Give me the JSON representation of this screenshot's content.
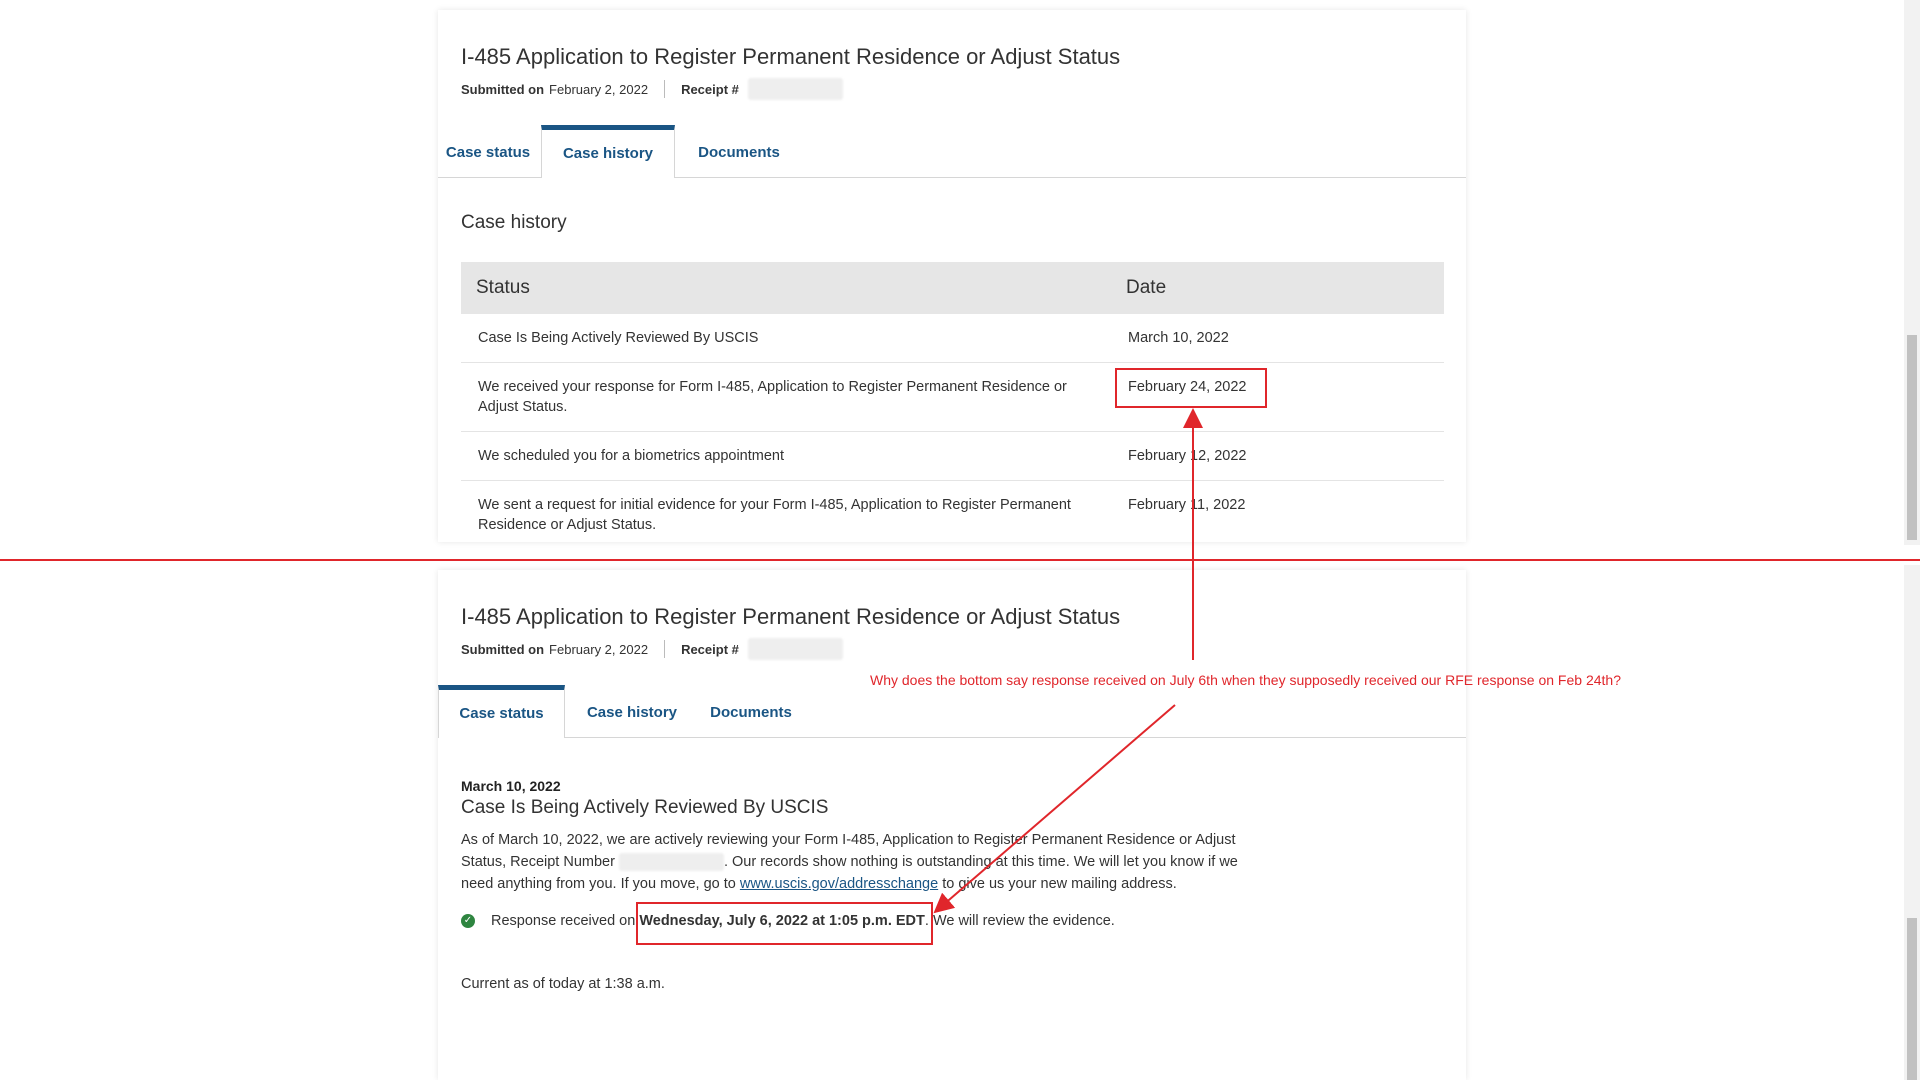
{
  "panel_top": {
    "form_title": "I-485 Application to Register Permanent Residence or Adjust Status",
    "submitted_label": "Submitted on",
    "submitted_date": "February 2, 2022",
    "receipt_label": "Receipt #",
    "tabs": [
      {
        "label": "Case status",
        "active": false
      },
      {
        "label": "Case history",
        "active": true
      },
      {
        "label": "Documents",
        "active": false
      }
    ],
    "section_title": "Case history",
    "table": {
      "headers": [
        "Status",
        "Date"
      ],
      "rows": [
        {
          "status": "Case Is Being Actively Reviewed By USCIS",
          "date": "March 10, 2022"
        },
        {
          "status": "We received your response for Form I-485, Application to Register Permanent Residence or Adjust Status.",
          "date": "February 24, 2022"
        },
        {
          "status": "We scheduled you for a biometrics appointment",
          "date": "February 12, 2022"
        },
        {
          "status": "We sent a request for initial evidence for your Form I-485, Application to Register Permanent Residence or Adjust Status.",
          "date": "February 11, 2022"
        }
      ]
    }
  },
  "panel_bottom": {
    "form_title": "I-485 Application to Register Permanent Residence or Adjust Status",
    "submitted_label": "Submitted on",
    "submitted_date": "February 2, 2022",
    "receipt_label": "Receipt #",
    "tabs": [
      {
        "label": "Case status",
        "active": true
      },
      {
        "label": "Case history",
        "active": false
      },
      {
        "label": "Documents",
        "active": false
      }
    ],
    "status_date": "March 10, 2022",
    "status_title": "Case Is Being Actively Reviewed By USCIS",
    "body_part1": "As of March 10, 2022, we are actively reviewing your Form I-485, Application to Register Permanent Residence or Adjust Status, Receipt Number",
    "body_part2": ". Our records show nothing is outstanding at this time. We will let you know if we need anything from you. If you move, go to",
    "link_text": "www.uscis.gov/addresschange",
    "body_part3": "to give us your new mailing address.",
    "response_prefix": "Response received on",
    "response_datetime": "Wednesday, July 6, 2022 at 1:05 p.m. EDT",
    "response_suffix": ". We will review the evidence.",
    "current_as_of": "Current as of today at 1:38 a.m."
  },
  "annotation": {
    "text": "Why does the bottom say response received on July 6th when they supposedly received our RFE response on Feb 24th?",
    "color": "#e0262b"
  },
  "colors": {
    "link": "#1a5584",
    "success": "#2e8540",
    "header_bg": "#e6e6e6"
  }
}
